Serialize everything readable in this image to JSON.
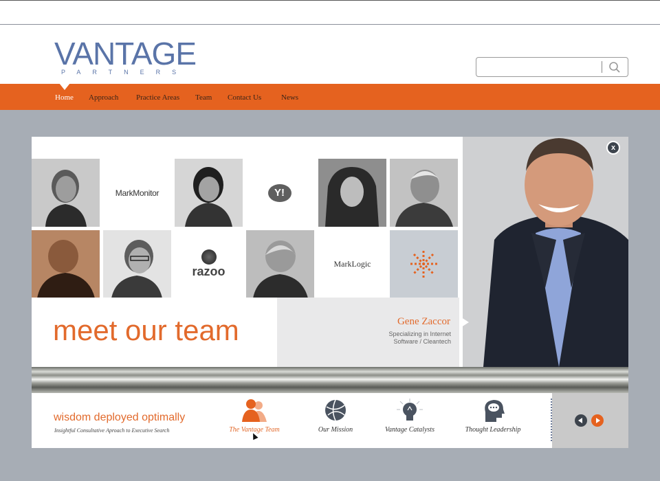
{
  "brand": {
    "logo_word": "VANTAGE",
    "logo_sub": "PARTNERS",
    "accent": "#e5621f",
    "logo_color": "#5a74a8"
  },
  "search": {
    "placeholder": "",
    "icon": "search-icon"
  },
  "nav": {
    "items": [
      "Home",
      "Approach",
      "Practice Areas",
      "Team",
      "Contact Us",
      "News"
    ],
    "active": "Home"
  },
  "grid": {
    "logos": [
      "MarkMonitor",
      "Y!",
      "razoo",
      "MarkLogic"
    ]
  },
  "meet": {
    "title": "meet our team"
  },
  "featured": {
    "name": "Gene Zaccor",
    "specialty_line1": "Specializing in Internet",
    "specialty_line2": "Software / Cleantech"
  },
  "close_label": "x",
  "footer": {
    "tagline": "wisdom deployed optimally",
    "subtitle": "Insightful Consultative Aproach to Executive Search",
    "items": [
      {
        "label": "The Vantage Team",
        "icon": "team-icon",
        "active": true
      },
      {
        "label": "Our Mission",
        "icon": "globe-icon",
        "active": false
      },
      {
        "label": "Vantage Catalysts",
        "icon": "lightbulb-icon",
        "active": false
      },
      {
        "label": "Thought Leadership",
        "icon": "head-speech-icon",
        "active": false
      }
    ]
  }
}
